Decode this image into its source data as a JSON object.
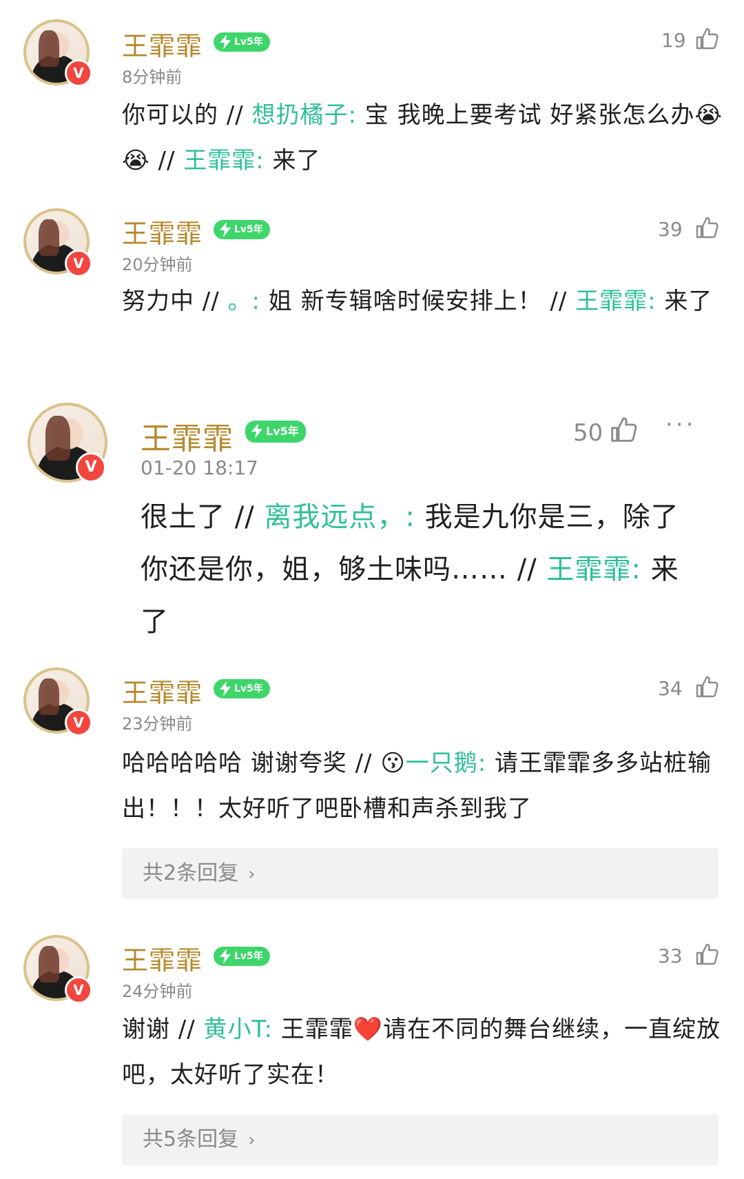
{
  "comments": [
    {
      "name": "王霏霏",
      "level": "Lv5年",
      "time": "8分钟前",
      "likes": "19",
      "text": "你可以的 // ",
      "segments": [
        {
          "t": "你可以的 // ",
          "link": false
        },
        {
          "t": "想扔橘子:",
          "link": true
        },
        {
          "t": " 宝 我晚上要考试 好紧张怎么办😭😭 // ",
          "link": false
        },
        {
          "t": "王霏霏:",
          "link": true
        },
        {
          "t": " 来了",
          "link": false
        }
      ]
    },
    {
      "name": "王霏霏",
      "level": "Lv5年",
      "time": "20分钟前",
      "likes": "39",
      "segments": [
        {
          "t": "努力中 // ",
          "link": false
        },
        {
          "t": "。:",
          "link": true
        },
        {
          "t": " 姐 新专辑啥时候安排上！ // ",
          "link": false
        },
        {
          "t": "王霏霏:",
          "link": true
        },
        {
          "t": " 来了",
          "link": false
        }
      ]
    },
    {
      "name": "王霏霏",
      "level": "Lv5年",
      "time": "01-20 18:17",
      "likes": "50",
      "more": "···",
      "segments": [
        {
          "t": "很土了 // ",
          "link": false
        },
        {
          "t": "离我远点，:",
          "link": true
        },
        {
          "t": " 我是九你是三，除了你还是你，姐，够土味吗…… // ",
          "link": false
        },
        {
          "t": "王霏霏:",
          "link": true
        },
        {
          "t": " 来了",
          "link": false
        }
      ]
    },
    {
      "name": "王霏霏",
      "level": "Lv5年",
      "time": "23分钟前",
      "likes": "34",
      "segments": [
        {
          "t": "哈哈哈哈哈 谢谢夸奖 // 😗",
          "link": false
        },
        {
          "t": "一只鹅:",
          "link": true
        },
        {
          "t": " 请王霏霏多多站桩输出！！！太好听了吧卧槽和声杀到我了",
          "link": false
        }
      ],
      "replies": "共2条回复"
    },
    {
      "name": "王霏霏",
      "level": "Lv5年",
      "time": "24分钟前",
      "likes": "33",
      "segments": [
        {
          "t": "谢谢 // ",
          "link": false
        },
        {
          "t": "黄小T:",
          "link": true
        },
        {
          "t": " 王霏霏❤️请在不同的舞台继续，一直绽放吧，太好听了实在！",
          "link": false
        }
      ],
      "replies": "共5条回复"
    }
  ],
  "colors": {
    "name": "#b58a2e",
    "link": "#2fbf9a",
    "level_badge": "#3ed66b",
    "verified": "#f2463e"
  },
  "icons": {
    "like": "thumbs-up-icon",
    "verified": "v-badge-icon",
    "level": "lightning-icon"
  }
}
